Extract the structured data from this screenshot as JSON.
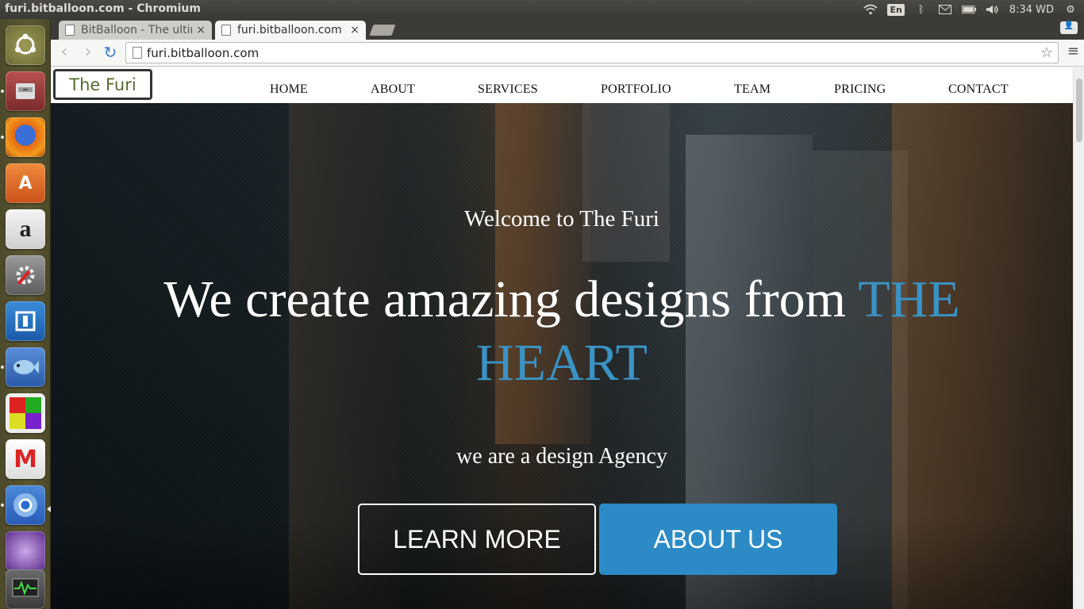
{
  "os": {
    "window_title": "furi.bitballoon.com - Chromium",
    "keyboard_layout": "En",
    "clock": "8:34 WD"
  },
  "launcher": {
    "items": [
      "Dash",
      "Files",
      "Firefox",
      "Ubuntu Software Center",
      "Amazon",
      "System Settings",
      "App",
      "Bluefish",
      "App",
      "Gmail",
      "Chromium",
      "App",
      "System Monitor"
    ]
  },
  "browser": {
    "tabs": [
      {
        "label": "BitBalloon - The ultir",
        "active": false
      },
      {
        "label": "furi.bitballoon.com",
        "active": true
      }
    ],
    "close_glyph": "×",
    "address": "furi.bitballoon.com"
  },
  "site": {
    "logo": "The Furi",
    "nav": [
      "HOME",
      "ABOUT",
      "SERVICES",
      "PORTFOLIO",
      "TEAM",
      "PRICING",
      "CONTACT"
    ],
    "welcome": "Welcome to The Furi",
    "headline_main": "We create amazing designs from ",
    "headline_accent": "THE HEART",
    "tagline": "we are a design Agency",
    "buttons": {
      "learn_more": "LEARN MORE",
      "about_us": "ABOUT US"
    },
    "accent_color": "#3a93c5",
    "button_color": "#2c8bc6"
  }
}
